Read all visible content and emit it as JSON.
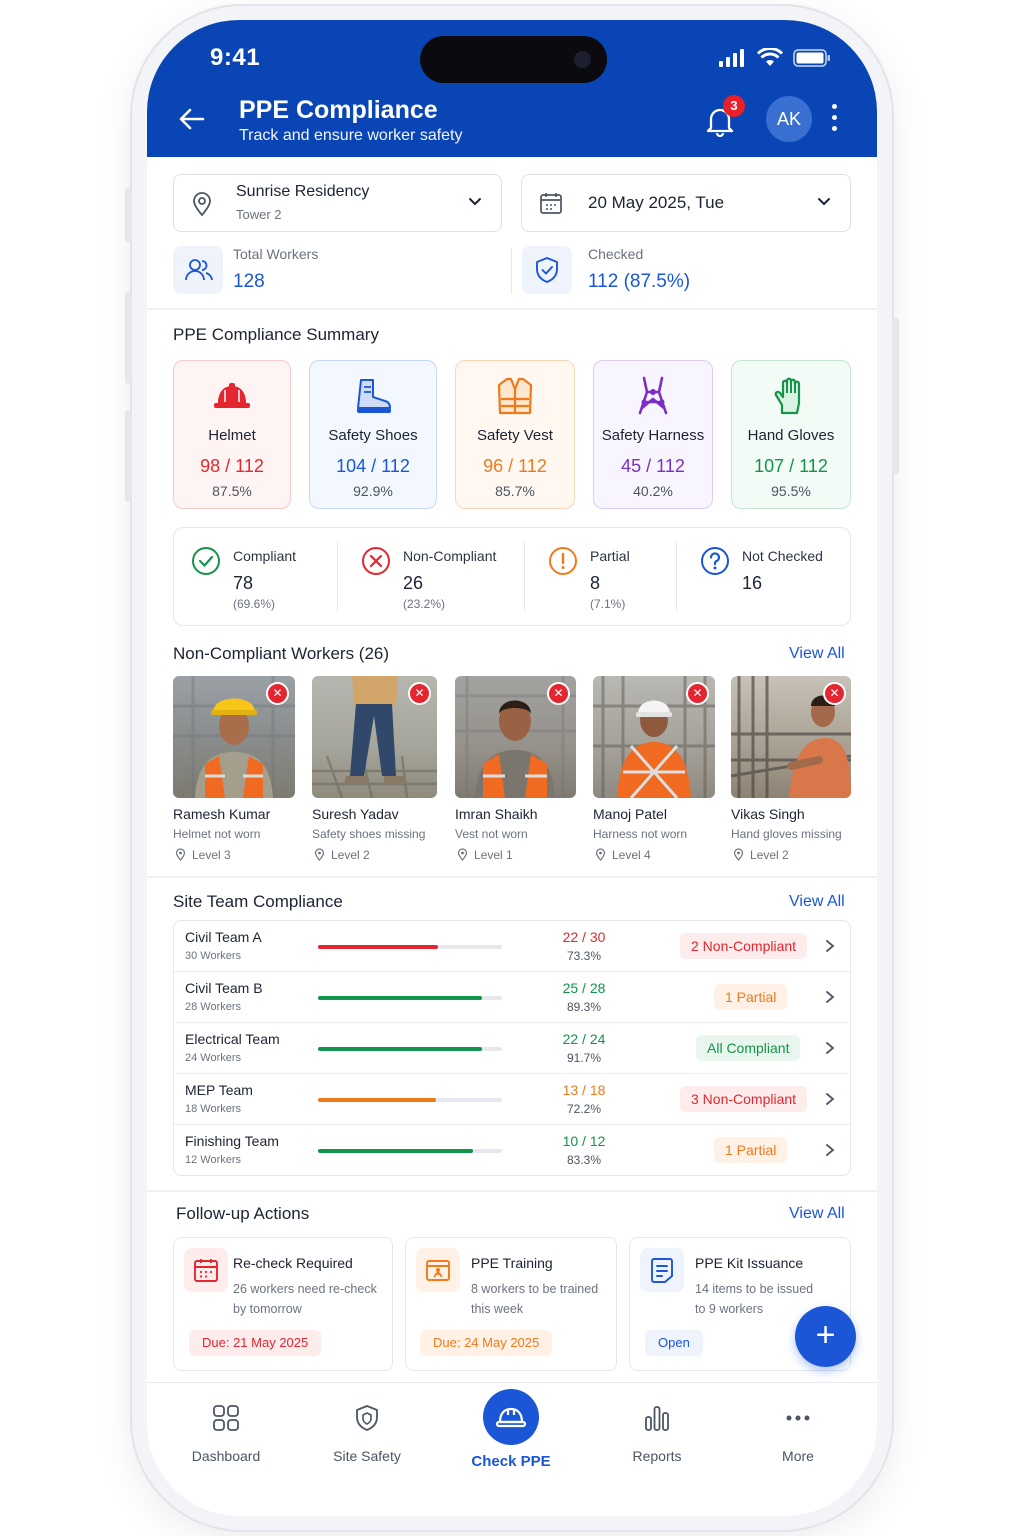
{
  "status_bar": {
    "time": "9:41"
  },
  "header": {
    "title": "PPE Compliance",
    "subtitle": "Track and ensure worker safety",
    "notification_count": "3",
    "avatar_initials": "AK",
    "bg_color": "#0a45b5"
  },
  "filters": {
    "site": {
      "name": "Sunrise Residency",
      "sub": "Tower 2"
    },
    "date": "20 May 2025, Tue"
  },
  "stats": {
    "total_label": "Total Workers",
    "total_value": "128",
    "checked_label": "Checked",
    "checked_value": "112  (87.5%)"
  },
  "summary": {
    "title": "PPE Compliance Summary",
    "items": [
      {
        "name": "Helmet",
        "count": "98 / 112",
        "pct": "87.5%",
        "color": "#e3262f",
        "icon": "helmet-icon"
      },
      {
        "name": "Safety Shoes",
        "count": "104 / 112",
        "pct": "92.9%",
        "color": "#1a56d6",
        "icon": "boot-icon"
      },
      {
        "name": "Safety Vest",
        "count": "96 / 112",
        "pct": "85.7%",
        "color": "#f07a1a",
        "icon": "vest-icon"
      },
      {
        "name": "Safety Harness",
        "count": "45 / 112",
        "pct": "40.2%",
        "color": "#7a2fc4",
        "icon": "harness-icon"
      },
      {
        "name": "Hand Gloves",
        "count": "107 / 112",
        "pct": "95.5%",
        "color": "#14934a",
        "icon": "glove-icon"
      }
    ]
  },
  "status_summary": [
    {
      "label": "Compliant",
      "value": "78",
      "pct": "(69.6%)",
      "color": "#14934a",
      "icon": "check-circle-icon"
    },
    {
      "label": "Non-Compliant",
      "value": "26",
      "pct": "(23.2%)",
      "color": "#e3262f",
      "icon": "x-circle-icon"
    },
    {
      "label": "Partial",
      "value": "8",
      "pct": "(7.1%)",
      "color": "#f07a1a",
      "icon": "alert-circle-icon"
    },
    {
      "label": "Not Checked",
      "value": "16",
      "pct": "",
      "color": "#1a56d6",
      "icon": "question-circle-icon"
    }
  ],
  "non_compliant": {
    "title": "Non-Compliant Workers (26)",
    "view_all": "View All",
    "workers": [
      {
        "name": "Ramesh Kumar",
        "issue": "Helmet not worn",
        "level": "Level 3"
      },
      {
        "name": "Suresh Yadav",
        "issue": "Safety shoes missing",
        "level": "Level 2"
      },
      {
        "name": "Imran Shaikh",
        "issue": "Vest not worn",
        "level": "Level 1"
      },
      {
        "name": "Manoj Patel",
        "issue": "Harness not worn",
        "level": "Level 4"
      },
      {
        "name": "Vikas Singh",
        "issue": "Hand gloves missing",
        "level": "Level 2"
      }
    ]
  },
  "teams": {
    "title": "Site Team Compliance",
    "view_all": "View All",
    "rows": [
      {
        "name": "Civil Team A",
        "workers": "30 Workers",
        "count": "22 / 30",
        "pct": "73.3%",
        "progress": 0.65,
        "status": "2 Non-Compliant",
        "tone": "red"
      },
      {
        "name": "Civil Team B",
        "workers": "28 Workers",
        "count": "25 / 28",
        "pct": "89.3%",
        "progress": 0.89,
        "status": "1 Partial",
        "tone": "orange"
      },
      {
        "name": "Electrical Team",
        "workers": "24 Workers",
        "count": "22 / 24",
        "pct": "91.7%",
        "progress": 0.89,
        "status": "All Compliant",
        "tone": "green"
      },
      {
        "name": "MEP Team",
        "workers": "18 Workers",
        "count": "13 / 18",
        "pct": "72.2%",
        "progress": 0.64,
        "status": "3 Non-Compliant",
        "tone": "red"
      },
      {
        "name": "Finishing Team",
        "workers": "12 Workers",
        "count": "10 / 12",
        "pct": "83.3%",
        "progress": 0.84,
        "status": "1 Partial",
        "tone": "orange"
      }
    ]
  },
  "actions": {
    "title": "Follow-up Actions",
    "view_all": "View All",
    "items": [
      {
        "title": "Re-check Required",
        "desc1": "26 workers need re-check",
        "desc2": "by tomorrow",
        "tag": "Due: 21 May 2025"
      },
      {
        "title": "PPE Training",
        "desc1": "8 workers to be trained",
        "desc2": "this week",
        "tag": "Due: 24 May 2025"
      },
      {
        "title": "PPE Kit Issuance",
        "desc1": "14 items to be issued",
        "desc2": "to 9 workers",
        "tag": "Open"
      }
    ]
  },
  "fab_label": "+",
  "nav": {
    "dashboard": "Dashboard",
    "site_safety": "Site Safety",
    "check_ppe": "Check PPE",
    "reports": "Reports",
    "more": "More"
  },
  "colors": {
    "primary": "#1a56d6",
    "green": "#14934a",
    "red": "#e3262f",
    "orange": "#f07a1a",
    "purple": "#7a2fc4"
  }
}
